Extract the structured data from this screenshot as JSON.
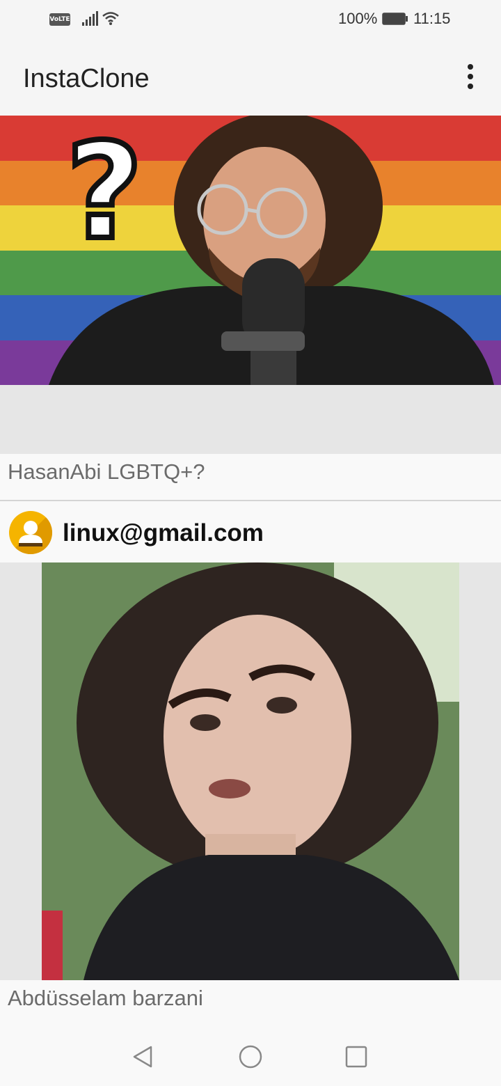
{
  "status_bar": {
    "volte": "VoLTE",
    "battery_percent": "100%",
    "time": "11:15",
    "icons": [
      "signal-icon",
      "wifi-icon",
      "battery-icon"
    ]
  },
  "app_bar": {
    "title": "InstaClone",
    "menu_icon": "more-vert-icon"
  },
  "feed": {
    "posts": [
      {
        "caption": "HasanAbi LGBTQ+?"
      },
      {
        "user": "linux@gmail.com",
        "avatar_icon": "user-avatar-icon",
        "caption": "Abdüsselam barzani"
      }
    ]
  },
  "nav_bar": {
    "buttons": [
      "back-icon",
      "home-icon",
      "recents-icon"
    ]
  },
  "colors": {
    "background": "#f5f5f5",
    "avatar": "#f5b400",
    "caption_text": "#6b6b6b"
  }
}
